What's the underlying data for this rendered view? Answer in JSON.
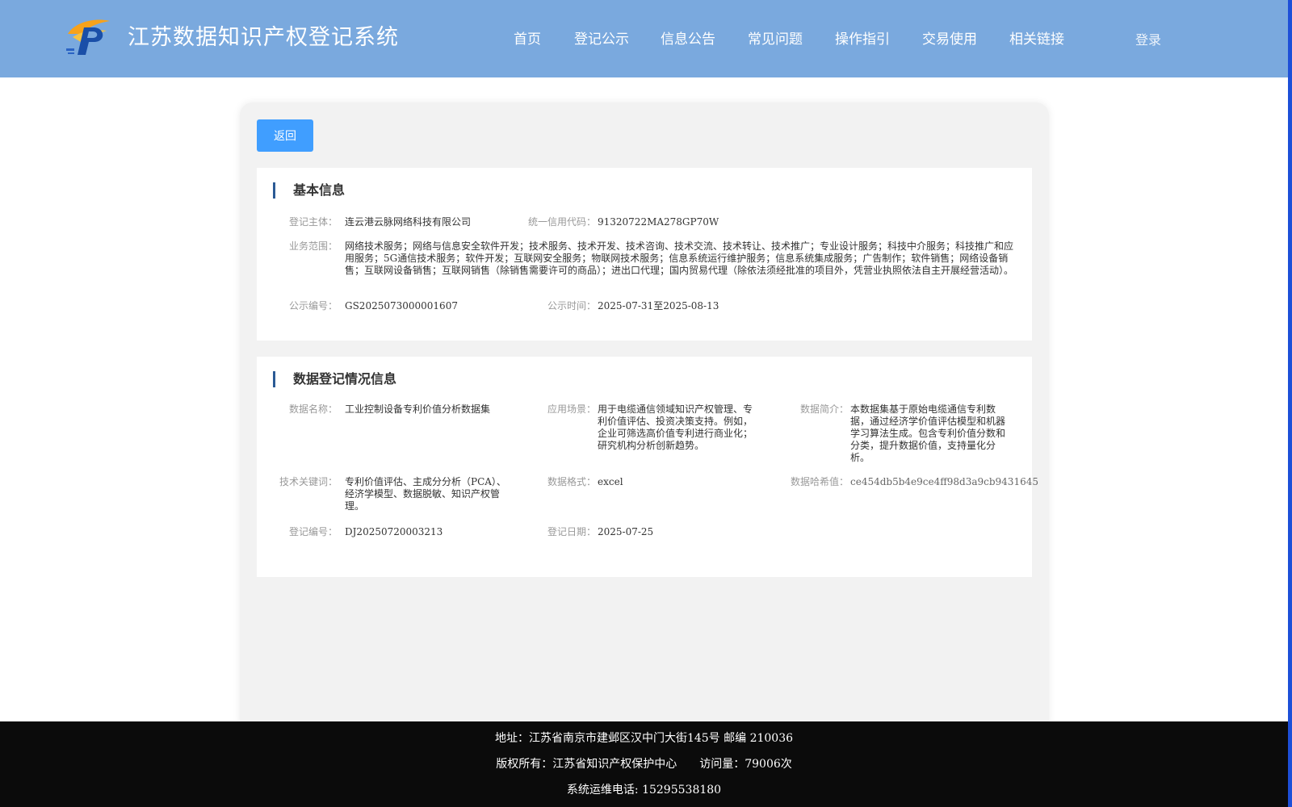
{
  "header": {
    "title": "江苏数据知识产权登记系统",
    "nav": [
      "首页",
      "登记公示",
      "信息公告",
      "常见问题",
      "操作指引",
      "交易使用",
      "相关链接"
    ],
    "login": "登录"
  },
  "colors": {
    "header_bg": "#7aa9de",
    "button_bg": "#409eff",
    "accent_bar": "#2b5a95",
    "footer_bg": "#0b0b0b"
  },
  "back_button": "返回",
  "basic": {
    "title": "基本信息",
    "subject_label": "登记主体：",
    "subject": "连云港云脉网络科技有限公司",
    "credit_label": "统一信用代码：",
    "credit": "91320722MA278GP70W",
    "scope_label": "业务范围：",
    "scope": "网络技术服务；网络与信息安全软件开发；技术服务、技术开发、技术咨询、技术交流、技术转让、技术推广；专业设计服务；科技中介服务；科技推广和应用服务；5G通信技术服务；软件开发；互联网安全服务；物联网技术服务；信息系统运行维护服务；信息系统集成服务；广告制作；软件销售；网络设备销售；互联网设备销售；互联网销售（除销售需要许可的商品）；进出口代理；国内贸易代理（除依法须经批准的项目外，凭营业执照依法自主开展经营活动）。",
    "pub_no_label": "公示编号：",
    "pub_no": "GS2025073000001607",
    "pub_time_label": "公示时间：",
    "pub_time": "2025-07-31至2025-08-13"
  },
  "data": {
    "title": "数据登记情况信息",
    "name_label": "数据名称：",
    "name": "工业控制设备专利价值分析数据集",
    "scene_label": "应用场景：",
    "scene": "用于电缆通信领域知识产权管理、专利价值评估、投资决策支持。例如，企业可筛选高价值专利进行商业化；研究机构分析创新趋势。",
    "intro_label": "数据简介：",
    "intro": "本数据集基于原始电缆通信专利数据，通过经济学价值评估模型和机器学习算法生成。包含专利价值分数和分类，提升数据价值，支持量化分析。",
    "keywords_label": "技术关键词：",
    "keywords": "专利价值评估、主成分分析（PCA）、经济学模型、数据脱敏、知识产权管理。",
    "format_label": "数据格式：",
    "format": "excel",
    "hash_label": "数据哈希值：",
    "hash": "ce454db5b4e9ce4ff98d3a9cb9431645",
    "reg_no_label": "登记编号：",
    "reg_no": "DJ20250720003213",
    "reg_date_label": "登记日期：",
    "reg_date": "2025-07-25"
  },
  "footer": {
    "address": "地址：江苏省南京市建邺区汉中门大街145号 邮编 210036",
    "copyright": "版权所有：江苏省知识产权保护中心　　访问量：79006次",
    "phone": "系统运维电话: 15295538180"
  }
}
